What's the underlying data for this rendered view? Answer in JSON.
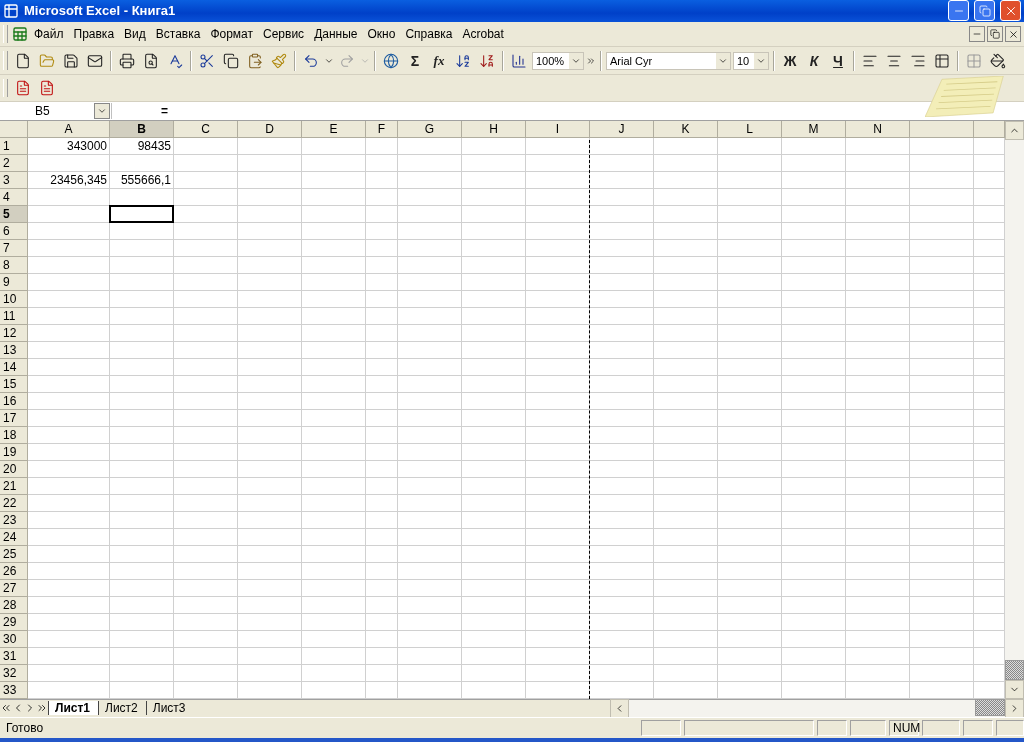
{
  "window": {
    "title": "Microsoft Excel - Книга1"
  },
  "menu": [
    "Файл",
    "Правка",
    "Вид",
    "Вставка",
    "Формат",
    "Сервис",
    "Данные",
    "Окно",
    "Справка",
    "Acrobat"
  ],
  "toolbar": {
    "redo": {
      "disabled": true
    },
    "zoom": "100%",
    "font": "Arial Cyr",
    "size": "10",
    "sum": "Σ",
    "function": "fx",
    "bold": "Ж",
    "italic": "К",
    "underline": "Ч"
  },
  "formula_bar": {
    "name_box": "B5",
    "equals": "="
  },
  "grid": {
    "columns": [
      {
        "label": "A",
        "selected": false
      },
      {
        "label": "B",
        "selected": true
      },
      {
        "label": "C",
        "selected": false
      },
      {
        "label": "D",
        "selected": false
      },
      {
        "label": "E",
        "selected": false
      },
      {
        "label": "F",
        "selected": false
      },
      {
        "label": "G",
        "selected": false
      },
      {
        "label": "H",
        "selected": false
      },
      {
        "label": "I",
        "selected": false,
        "page_break": true
      },
      {
        "label": "J",
        "selected": false
      },
      {
        "label": "K",
        "selected": false
      },
      {
        "label": "L",
        "selected": false
      },
      {
        "label": "M",
        "selected": false
      },
      {
        "label": "N",
        "selected": false
      },
      {
        "selected": false
      },
      {
        "selected": false
      }
    ],
    "rows": [
      {
        "label": "1",
        "selected": false,
        "cells": [
          "343000",
          "98435"
        ]
      },
      {
        "label": "2",
        "selected": false
      },
      {
        "label": "3",
        "selected": false,
        "cells": [
          "23456,345",
          "555666,1"
        ]
      },
      {
        "label": "4",
        "selected": false
      },
      {
        "label": "5",
        "selected": true
      },
      {
        "label": "6",
        "selected": false
      },
      {
        "label": "7",
        "selected": false
      },
      {
        "label": "8",
        "selected": false
      },
      {
        "label": "9",
        "selected": false
      },
      {
        "label": "10",
        "selected": false
      },
      {
        "label": "11",
        "selected": false
      },
      {
        "label": "12",
        "selected": false
      },
      {
        "label": "13",
        "selected": false
      },
      {
        "label": "14",
        "selected": false
      },
      {
        "label": "15",
        "selected": false
      },
      {
        "label": "16",
        "selected": false
      },
      {
        "label": "17",
        "selected": false
      },
      {
        "label": "18",
        "selected": false
      },
      {
        "label": "19",
        "selected": false
      },
      {
        "label": "20",
        "selected": false
      },
      {
        "label": "21",
        "selected": false
      },
      {
        "label": "22",
        "selected": false
      },
      {
        "label": "23",
        "selected": false
      },
      {
        "label": "24",
        "selected": false
      },
      {
        "label": "25",
        "selected": false
      },
      {
        "label": "26",
        "selected": false
      },
      {
        "label": "27",
        "selected": false
      },
      {
        "label": "28",
        "selected": false
      },
      {
        "label": "29",
        "selected": false
      },
      {
        "label": "30",
        "selected": false
      },
      {
        "label": "31",
        "selected": false
      },
      {
        "label": "32",
        "selected": false
      },
      {
        "label": "33",
        "selected": false
      }
    ]
  },
  "sheet_tabs": [
    {
      "label": "Лист1",
      "selected": true
    },
    {
      "label": "Лист2",
      "selected": false
    },
    {
      "label": "Лист3",
      "selected": false
    }
  ],
  "status_bar": {
    "text": "Готово",
    "indicator": "NUM"
  }
}
